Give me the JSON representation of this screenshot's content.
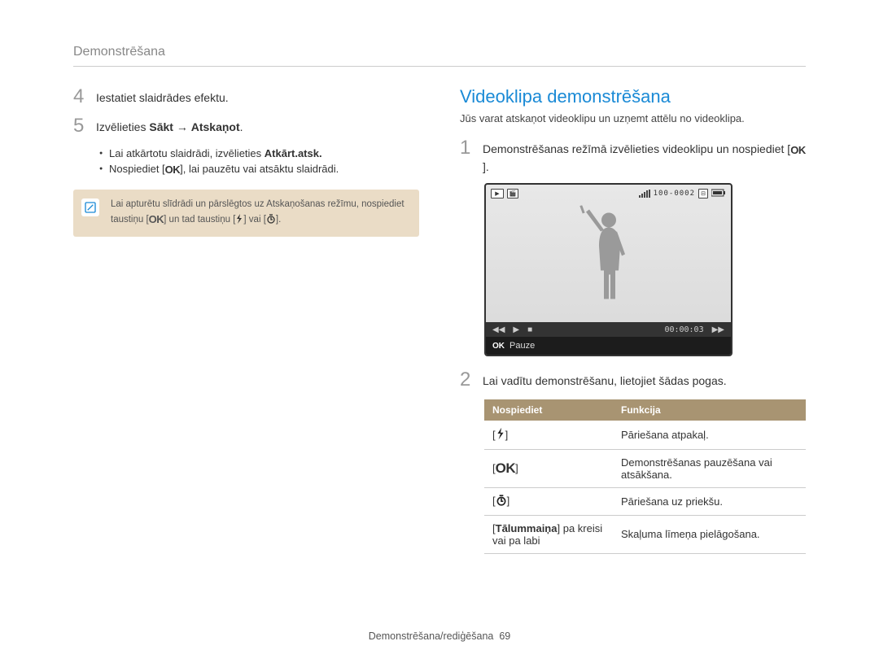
{
  "header": "Demonstrēšana",
  "left": {
    "step4": {
      "num": "4",
      "text": "Iestatiet slaidrādes efektu."
    },
    "step5": {
      "num": "5",
      "prefix": "Izvēlieties ",
      "bold1": "Sākt",
      "arrow": " → ",
      "bold2": "Atskaņot",
      "suffix": "."
    },
    "bullet1_a": "Lai atkārtotu slaidrādi, izvēlieties ",
    "bullet1_b": "Atkārt.atsk.",
    "bullet2_a": "Nospiediet [",
    "bullet2_b": "], lai pauzētu vai atsāktu slaidrādi.",
    "note_a": "Lai apturētu slīdrādi un pārslēgtos uz Atskaņošanas režīmu, nospiediet taustiņu [",
    "note_b": "] un tad taustiņu [",
    "note_c": "] vai [",
    "note_d": "]."
  },
  "right": {
    "title": "Videoklipa demonstrēšana",
    "intro": "Jūs varat atskaņot videoklipu un uzņemt attēlu no videoklipa.",
    "step1": {
      "num": "1",
      "text_a": "Demonstrēšanas režīmā izvēlieties videoklipu un nospiediet [",
      "text_b": "]."
    },
    "screen": {
      "counter": "100-0002",
      "time": "00:00:03",
      "caption": "Pauze"
    },
    "step2": {
      "num": "2",
      "text": "Lai vadītu demonstrēšanu, lietojiet šādas pogas."
    },
    "table": {
      "h1": "Nospiediet",
      "h2": "Funkcija",
      "rows": [
        {
          "k": "flash",
          "v": "Pāriešana atpakaļ."
        },
        {
          "k": "ok",
          "v": "Demonstrēšanas pauzēšana vai atsākšana."
        },
        {
          "k": "timer",
          "v": "Pāriešana uz priekšu."
        },
        {
          "k_a": "[",
          "k_b": "Tālummaiņa",
          "k_c": "] pa kreisi vai pa labi",
          "v": "Skaļuma līmeņa pielāgošana."
        }
      ]
    }
  },
  "footer": {
    "label": "Demonstrēšana/rediģēšana",
    "page": "69"
  },
  "ok": "OK"
}
